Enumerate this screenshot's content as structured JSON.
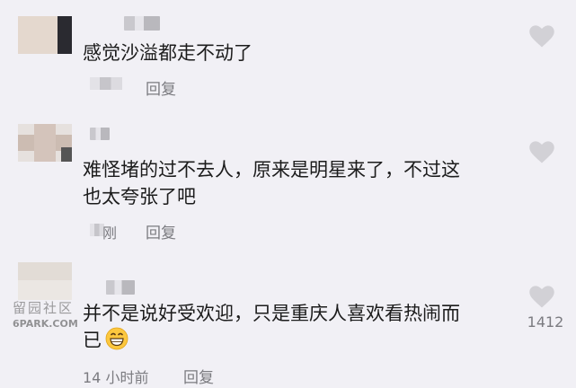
{
  "comments": [
    {
      "text_lines": [
        "感觉沙溢都走不动了"
      ],
      "reply_label": "回复"
    },
    {
      "text_lines": [
        "难怪堵的过不去人，原来是明星来了，不过这",
        "也太夸张了吧"
      ],
      "time_partial": "刚",
      "reply_label": "回复"
    },
    {
      "text_lines": [
        "并不是说好受欢迎，只是重庆人喜欢看热闹而",
        "已"
      ],
      "emoji": "grinning-face-emoji",
      "time": "14 小时前",
      "reply_label": "回复",
      "like_count": "1412"
    }
  ],
  "like_icon": "heart-icon",
  "colors": {
    "background": "#f1f0f5",
    "text": "#1c1c1c",
    "meta": "#7b7b80",
    "heart": "#d2d1d6"
  },
  "watermark": {
    "line1": "留园社区",
    "line2": "6PARK.COM"
  }
}
